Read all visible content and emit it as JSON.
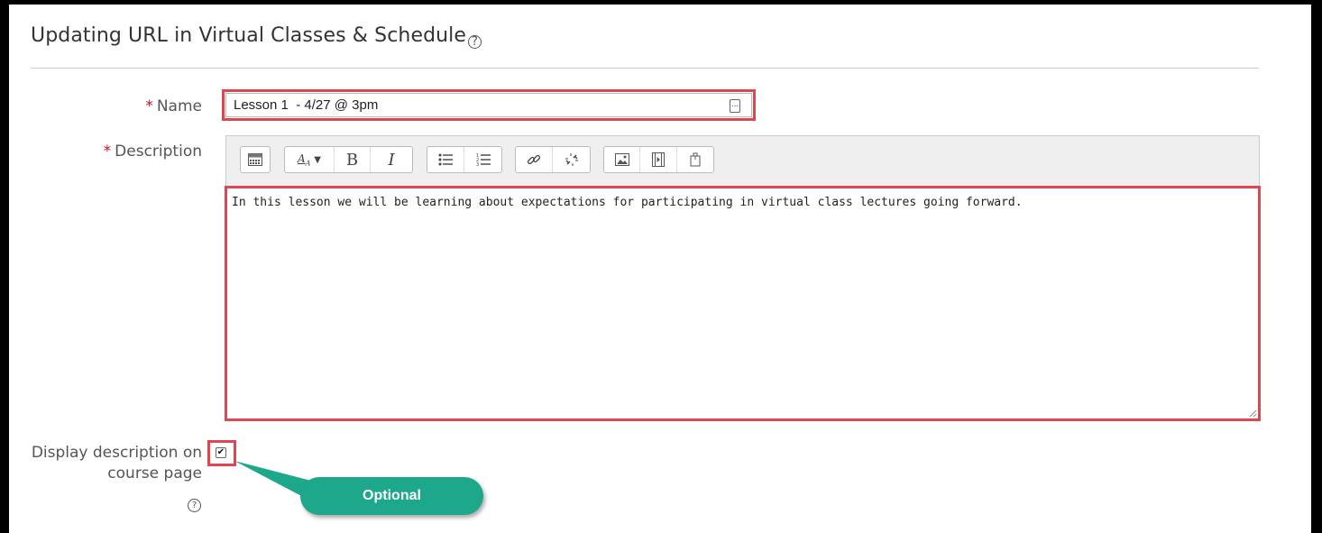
{
  "page": {
    "title": "Updating URL in Virtual Classes & Schedule"
  },
  "form": {
    "name": {
      "required_marker": "*",
      "label": "Name",
      "value": "Lesson 1  - 4/27 @ 3pm"
    },
    "description": {
      "required_marker": "*",
      "label": "Description",
      "content": "In this lesson we will be learning about expectations for participating in virtual class lectures going forward.",
      "toolbar_groups": [
        [
          "toggle-toolbar-icon"
        ],
        [
          "font-size-icon",
          "bold-icon",
          "italic-icon"
        ],
        [
          "bullet-list-icon",
          "numbered-list-icon"
        ],
        [
          "link-icon",
          "unlink-icon"
        ],
        [
          "image-icon",
          "media-icon",
          "manage-files-icon"
        ]
      ],
      "toolbar_labels": {
        "bold": "B",
        "italic": "I"
      }
    },
    "display_description": {
      "label": "Display description on course page",
      "checked": true
    }
  },
  "annotation": {
    "optional_label": "Optional",
    "highlight_color": "#e0464f",
    "badge_color": "#1ea88b"
  },
  "colors": {
    "required": "#c8102e",
    "label_text": "#555555"
  }
}
